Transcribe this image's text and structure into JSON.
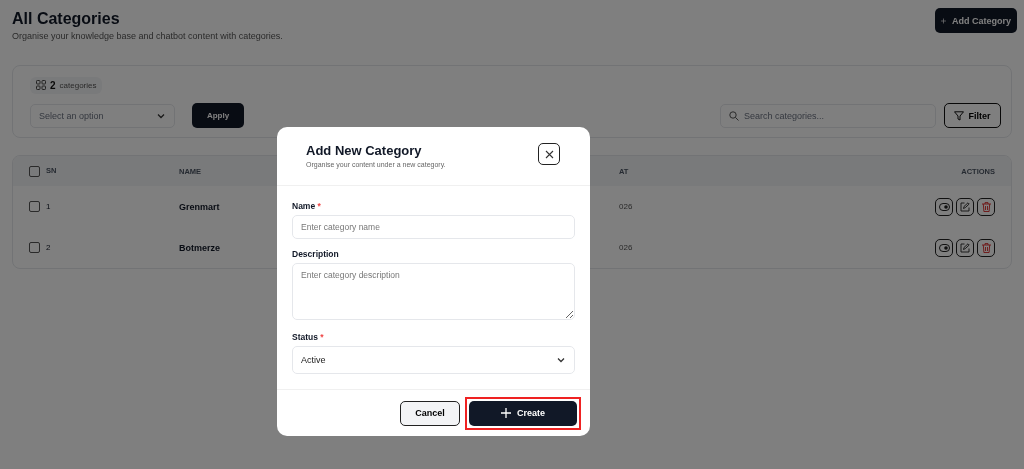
{
  "header": {
    "title": "All Categories",
    "subtitle": "Organise your knowledge base and chatbot content with categories.",
    "add_button": "Add Category"
  },
  "filters": {
    "count": "2",
    "count_label": "categories",
    "select": {
      "placeholder": "Select an option"
    },
    "apply": "Apply",
    "search": {
      "placeholder": "Search categories..."
    },
    "filter": "Filter"
  },
  "table": {
    "all_checked": false,
    "columns": [
      {
        "label": "SN",
        "kind": "check"
      },
      {
        "label": "NAME",
        "kind": "text"
      },
      {
        "label": "AT",
        "kind": "date"
      },
      {
        "label": "ACTIONS",
        "kind": "actions"
      }
    ],
    "rows": [
      {
        "sn": "1",
        "name": "Grenmart",
        "date": "026",
        "checked": false
      },
      {
        "sn": "2",
        "name": "Botmerze",
        "date": "026",
        "checked": false
      }
    ]
  },
  "dialog": {
    "title": "Add New Category",
    "subtitle": "Organise your content under a new category.",
    "fields": [
      {
        "kind": "input",
        "label": "Name",
        "required_mark": "*",
        "placeholder": "Enter category name"
      },
      {
        "kind": "textarea",
        "label": "Description",
        "placeholder": "Enter category description"
      },
      {
        "kind": "select",
        "label": "Status",
        "required_mark": "*",
        "value": "Active"
      }
    ],
    "buttons": [
      {
        "label": "Cancel",
        "kind": "secondary",
        "highlighted": false
      },
      {
        "label": "Create",
        "kind": "primary",
        "highlighted": true
      }
    ]
  }
}
